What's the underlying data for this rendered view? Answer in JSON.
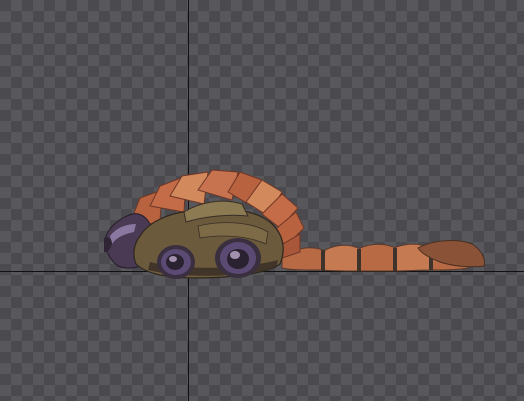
{
  "viewport": {
    "background": "checkerboard",
    "checker_dark": "#4b4b4f",
    "checker_light": "#58585c",
    "axis_color": "#111114"
  },
  "model": {
    "kind": "armadillo-like creature (side view)",
    "colors": {
      "shell_main": "#b8623f",
      "shell_light": "#d28a5d",
      "shell_dark": "#7a3c2c",
      "body_olive": "#6b5a3c",
      "body_dark": "#3a2f26",
      "wheel_purple": "#5b4a74",
      "wheel_highlight": "#cbb6d8",
      "tail_orange": "#b86a45",
      "tail_band_dark": "#3d332b"
    }
  }
}
